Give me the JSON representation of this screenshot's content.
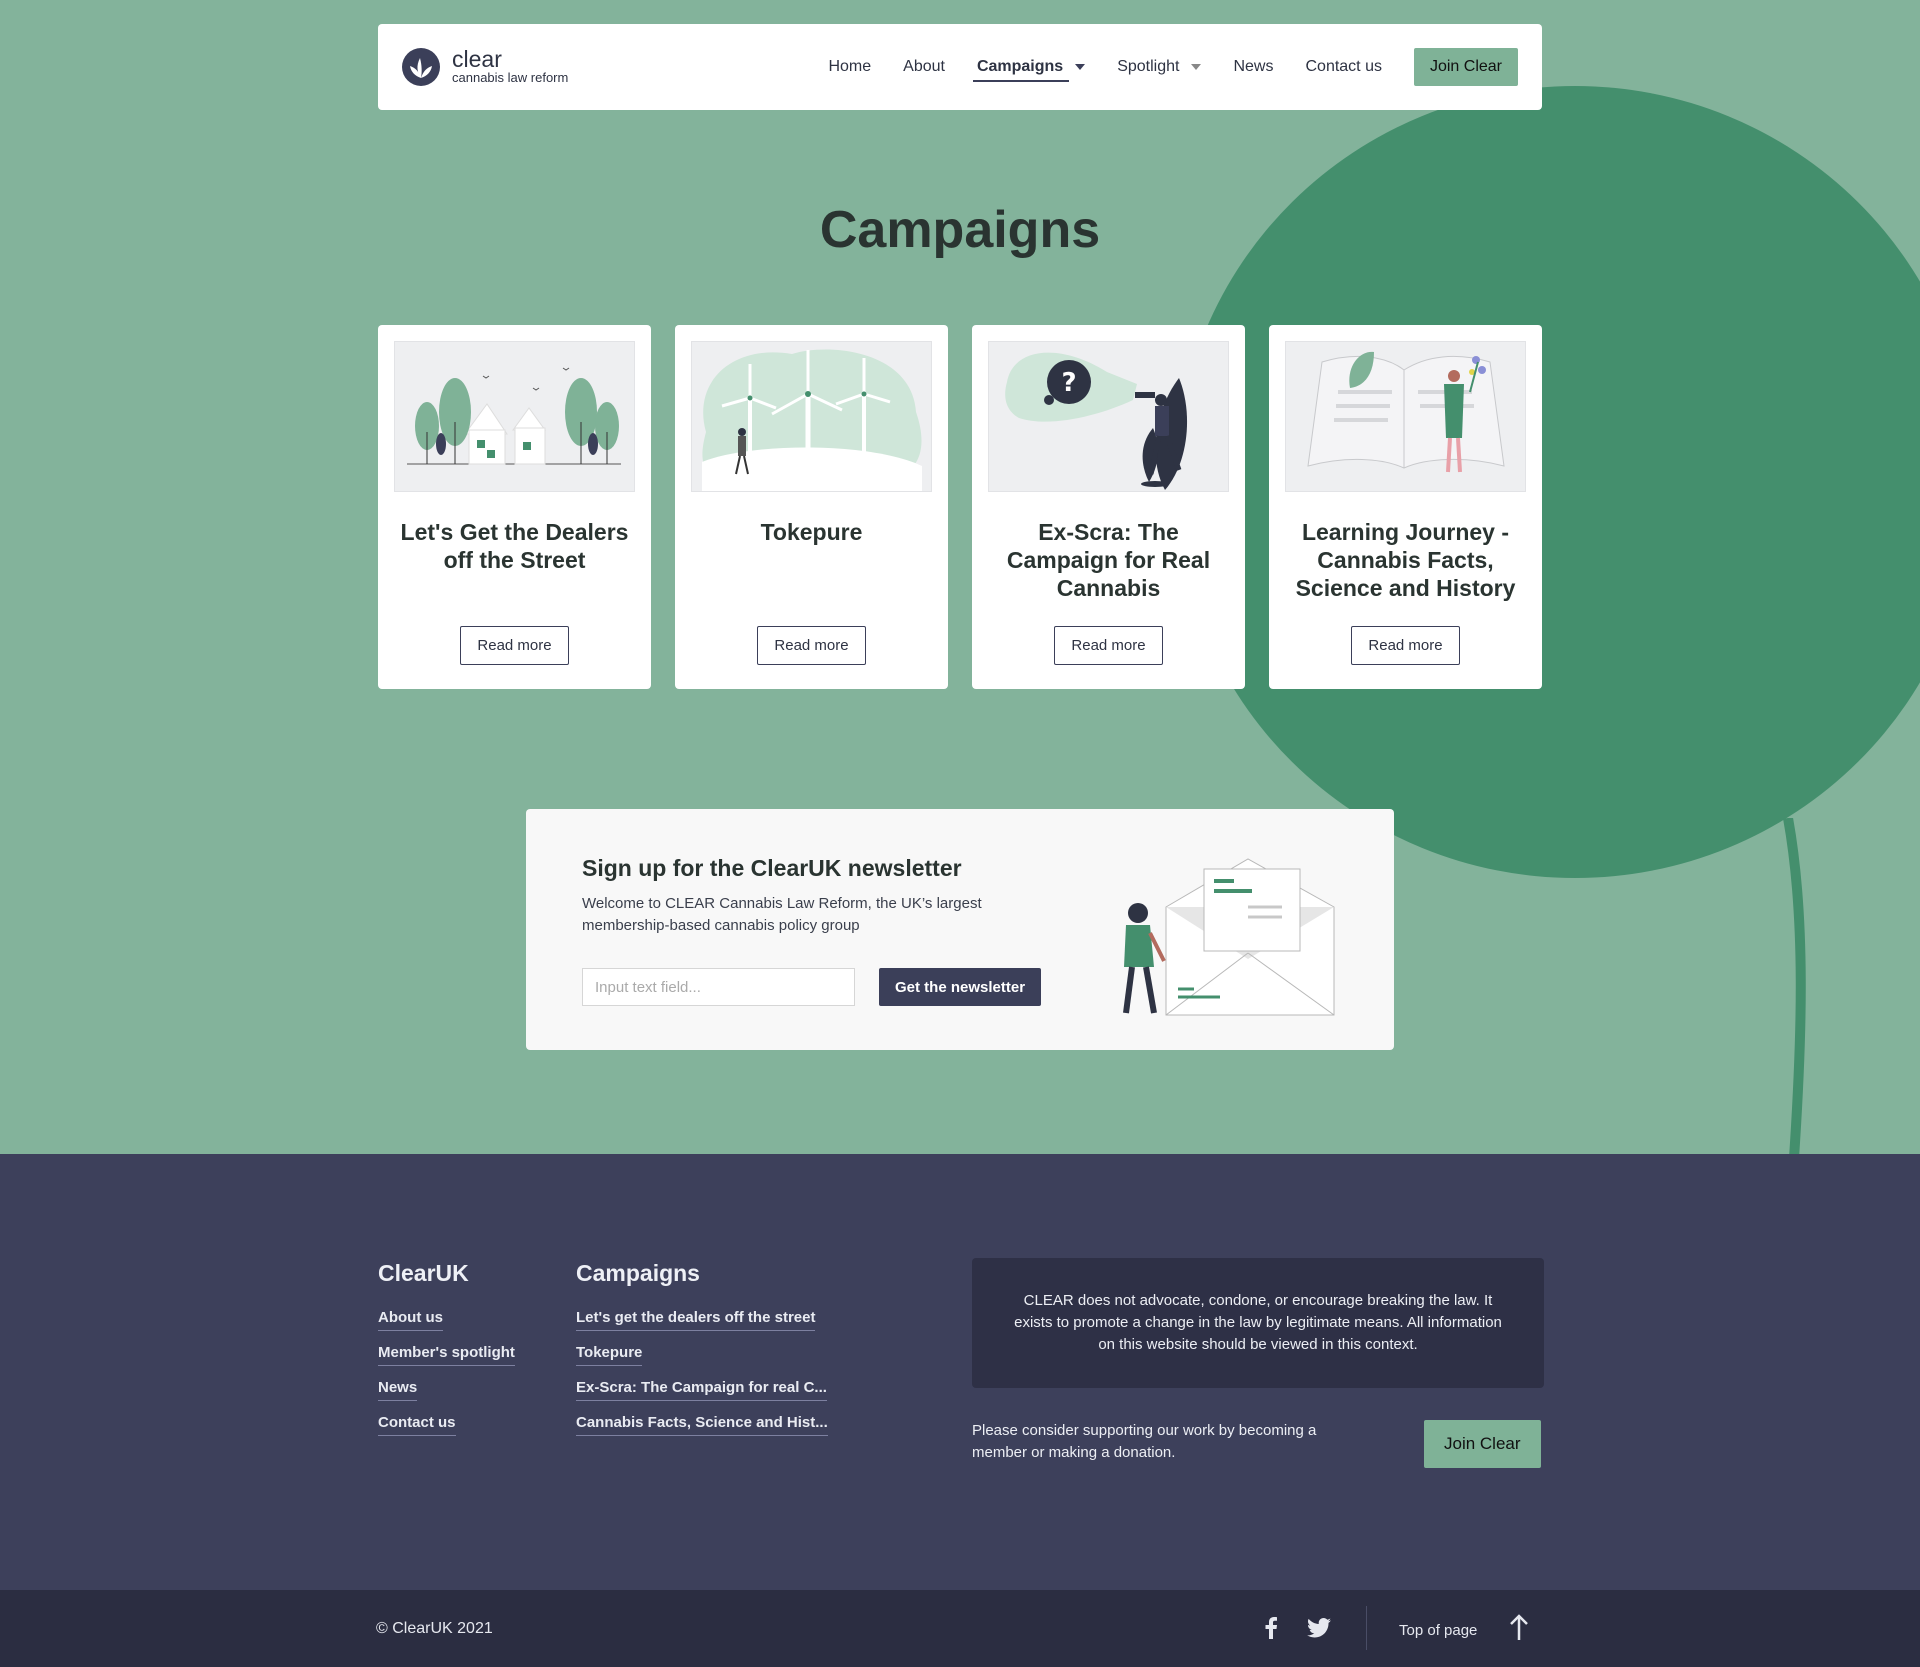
{
  "brand": {
    "name": "clear",
    "tagline": "cannabis law reform"
  },
  "nav": {
    "items": [
      {
        "label": "Home"
      },
      {
        "label": "About"
      },
      {
        "label": "Campaigns",
        "active": true,
        "dropdown": true
      },
      {
        "label": "Spotlight",
        "dropdown": true
      },
      {
        "label": "News"
      },
      {
        "label": "Contact us"
      }
    ],
    "join_label": "Join Clear"
  },
  "page": {
    "title": "Campaigns"
  },
  "campaigns": [
    {
      "title": "Let's Get the Dealers off the Street",
      "button": "Read more"
    },
    {
      "title": "Tokepure",
      "button": "Read more"
    },
    {
      "title": "Ex-Scra: The Campaign for Real Cannabis",
      "button": "Read more"
    },
    {
      "title": "Learning Journey - Cannabis Facts, Science and History",
      "button": "Read more"
    }
  ],
  "newsletter": {
    "title": "Sign up for the ClearUK newsletter",
    "description": "Welcome to CLEAR Cannabis Law Reform, the UK’s largest membership-based cannabis policy group",
    "input_placeholder": "Input text field...",
    "button": "Get the newsletter"
  },
  "footer": {
    "col1": {
      "title": "ClearUK",
      "links": [
        "About us",
        "Member's spotlight",
        "News",
        "Contact us"
      ]
    },
    "col2": {
      "title": "Campaigns",
      "links": [
        "Let's get the dealers off the street",
        "Tokepure",
        "Ex-Scra: The Campaign for real C...",
        "Cannabis Facts, Science and Hist..."
      ]
    },
    "disclaimer": "CLEAR does not advocate, condone, or encourage breaking the law. It exists to promote a change in the law by legitimate means. All information on this website should be viewed in this context.",
    "support_text": "Please consider supporting our work by becoming a member or making a donation.",
    "join_label": "Join Clear"
  },
  "bottom": {
    "copyright": "© ClearUK 2021",
    "top_label": "Top of page",
    "social": [
      "facebook-icon",
      "twitter-icon"
    ]
  },
  "colors": {
    "background": "#83b39b",
    "accent_green": "#448f6d",
    "button_green": "#7fb297",
    "navy": "#3b3f59",
    "footer": "#3d405b",
    "bottom_bar": "#2b2d41"
  }
}
